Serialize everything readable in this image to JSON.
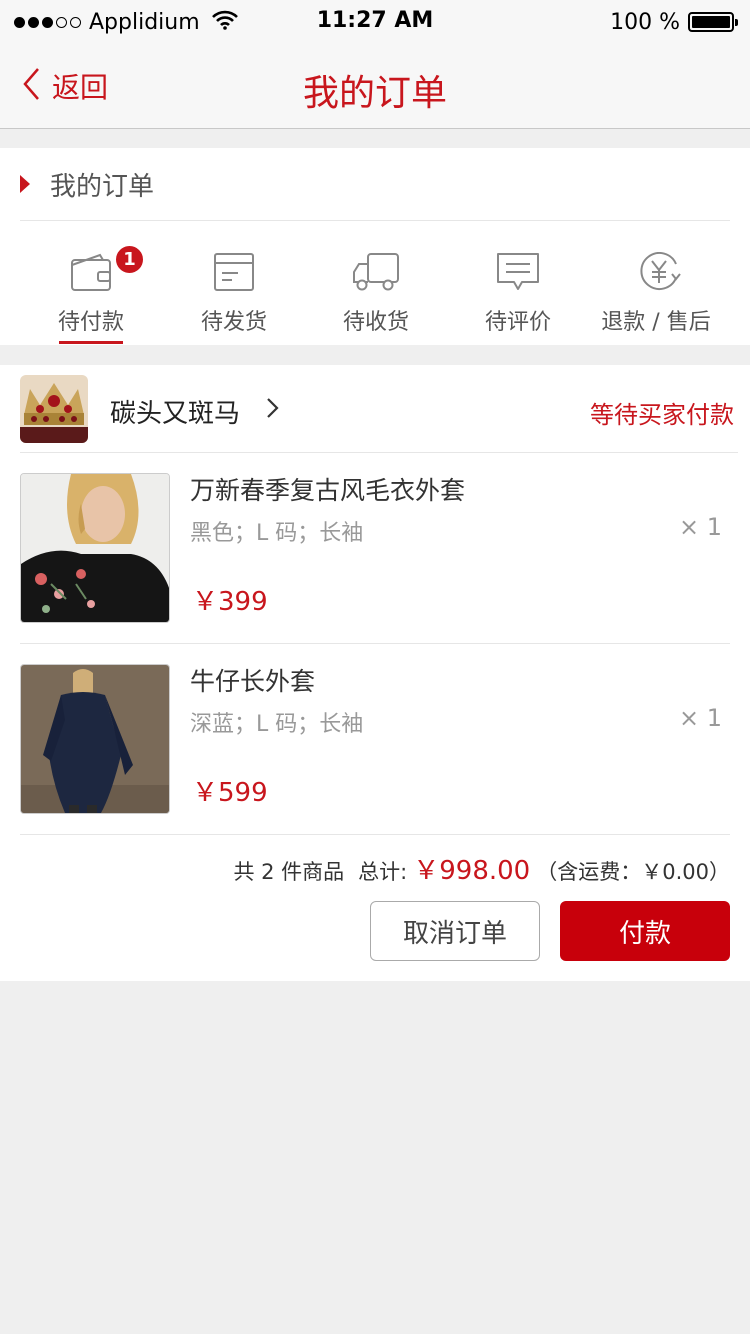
{
  "status_bar": {
    "carrier": "Applidium",
    "time": "11:27 AM",
    "battery": "100 %"
  },
  "nav": {
    "back_label": "返回",
    "title": "我的订单"
  },
  "orders_section": {
    "heading": "我的订单",
    "statuses": [
      {
        "label": "待付款",
        "icon": "wallet-icon",
        "badge": "1",
        "active": true
      },
      {
        "label": "待发货",
        "icon": "box-icon"
      },
      {
        "label": "待收货",
        "icon": "truck-icon"
      },
      {
        "label": "待评价",
        "icon": "comment-icon"
      },
      {
        "label": "退款 / 售后",
        "icon": "refund-yen-icon"
      }
    ]
  },
  "order": {
    "shop_name": "碳头又斑马",
    "status": "等待买家付款",
    "items": [
      {
        "name": "万新春季复古风毛衣外套",
        "spec": "黑色；L 码；长袖",
        "qty": "× 1",
        "price": "￥399"
      },
      {
        "name": "牛仔长外套",
        "spec": "深蓝；L 码；长袖",
        "qty": "× 1",
        "price": "￥599"
      }
    ],
    "summary": {
      "count_text": "共 2 件商品",
      "total_label": "总计:",
      "total": "￥998.00",
      "shipping": "（含运费：￥0.00）"
    },
    "cancel_label": "取消订单",
    "pay_label": "付款"
  },
  "colors": {
    "accent": "#c8161d",
    "pay_button": "#c8000b",
    "background": "#efefef"
  }
}
